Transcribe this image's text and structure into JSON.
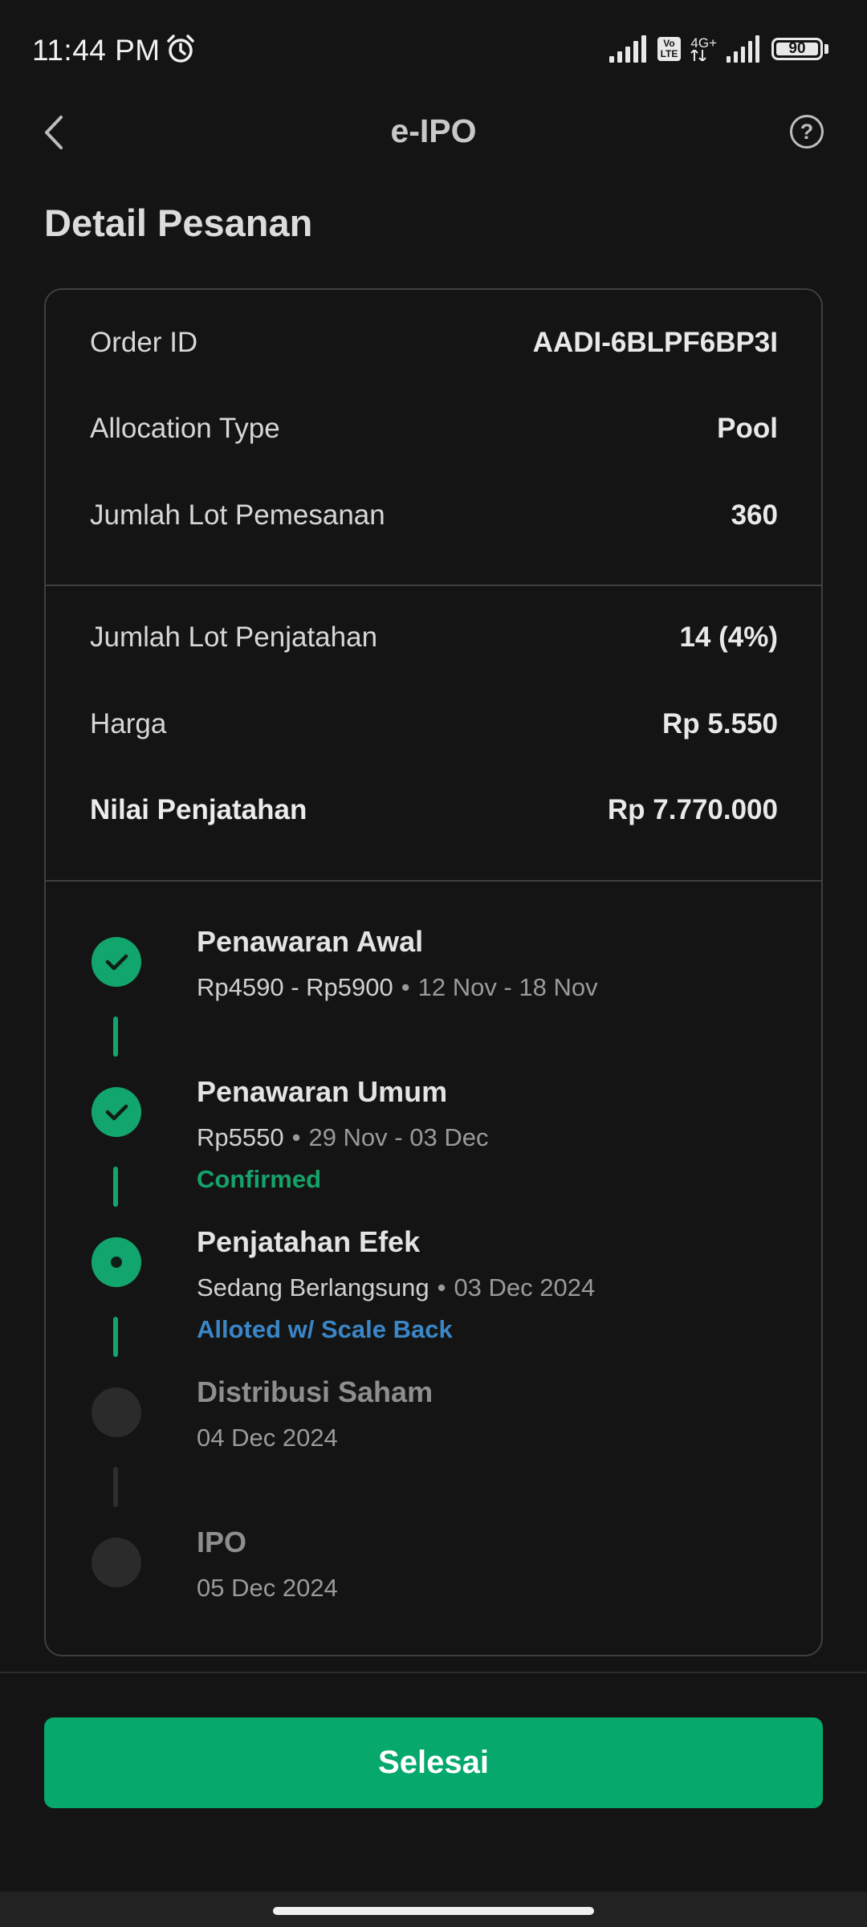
{
  "status_bar": {
    "time": "11:44 PM",
    "volte": "Vo\nLTE",
    "network": "4G+",
    "battery": "90"
  },
  "app_bar": {
    "title": "e-IPO",
    "help_icon": "?"
  },
  "page_title": "Detail Pesanan",
  "order_info": [
    {
      "label": "Order ID",
      "value": "AADI-6BLPF6BP3I"
    },
    {
      "label": "Allocation Type",
      "value": "Pool"
    },
    {
      "label": "Jumlah Lot Pemesanan",
      "value": "360"
    }
  ],
  "allotment_info": [
    {
      "label": "Jumlah Lot Penjatahan",
      "value": "14 (4%)"
    },
    {
      "label": "Harga",
      "value": "Rp 5.550"
    },
    {
      "label": "Nilai Penjatahan",
      "value": "Rp 7.770.000"
    }
  ],
  "timeline": [
    {
      "title": "Penawaran Awal",
      "detail": "Rp4590 - Rp5900",
      "date": "12 Nov - 18 Nov",
      "status": "",
      "state": "done"
    },
    {
      "title": "Penawaran Umum",
      "detail": "Rp5550",
      "date": "29 Nov - 03 Dec",
      "status": "Confirmed",
      "state": "done"
    },
    {
      "title": "Penjatahan Efek",
      "detail": "Sedang Berlangsung",
      "date": "03 Dec 2024",
      "status": "Alloted w/ Scale Back",
      "state": "active"
    },
    {
      "title": "Distribusi Saham",
      "detail": "",
      "date": "04 Dec 2024",
      "status": "",
      "state": "pending"
    },
    {
      "title": "IPO",
      "detail": "",
      "date": "05 Dec 2024",
      "status": "",
      "state": "pending"
    }
  ],
  "separator": "•",
  "button": {
    "label": "Selesai"
  },
  "colors": {
    "accent": "#06a86c",
    "status_blue": "#3a86c7",
    "background": "#141414"
  }
}
